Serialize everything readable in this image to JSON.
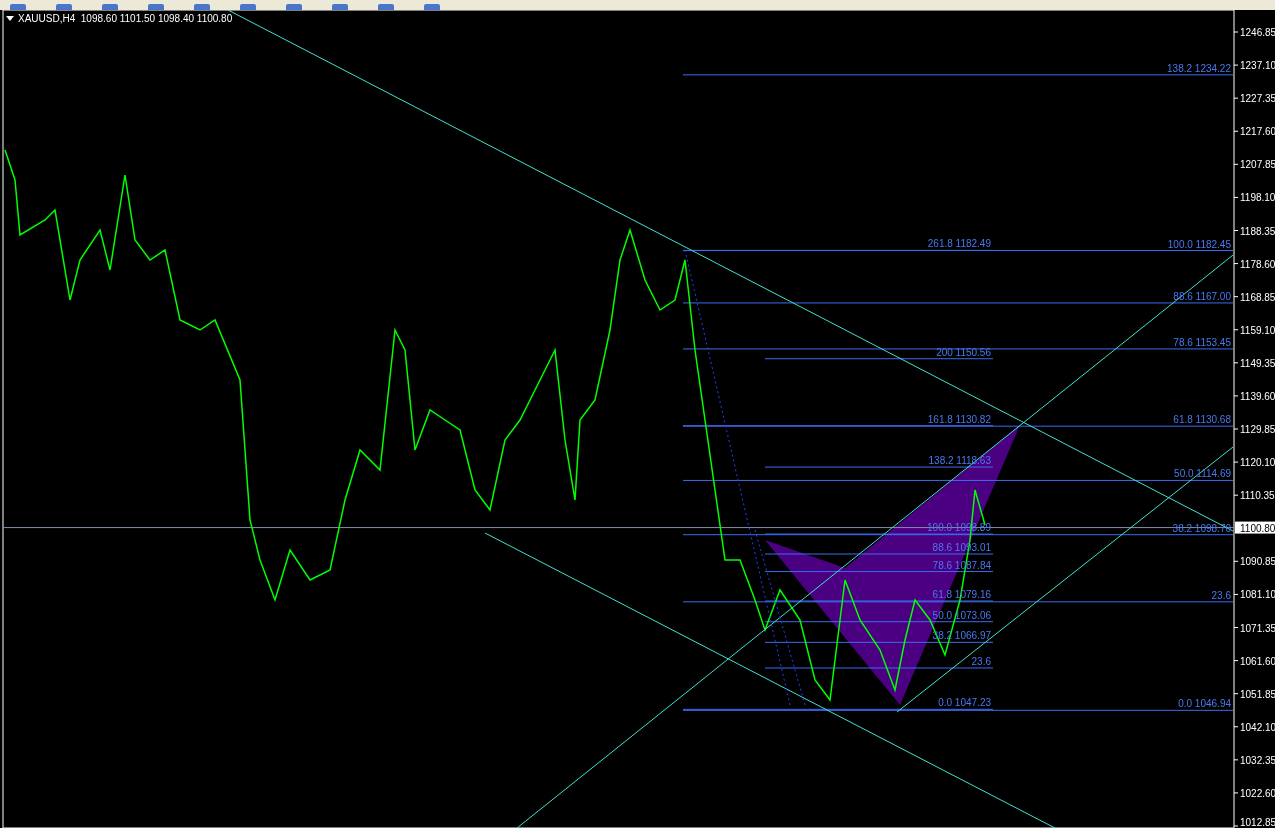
{
  "chart": {
    "title": "XAUUSD,H4  1098.60 1101.50 1098.40 1100.80",
    "axis_labels": [
      "1246.85",
      "1237.10",
      "1227.35",
      "1217.60",
      "1207.85",
      "1198.10",
      "1188.35",
      "1178.60",
      "1168.85",
      "1159.10",
      "1149.35",
      "1139.60",
      "1129.85",
      "1120.10",
      "1110.35",
      "1090.85",
      "1081.10",
      "1071.35",
      "1061.60",
      "1051.85",
      "1042.10",
      "1032.35",
      "1022.60",
      "1012.85"
    ],
    "price_tag": "1100.80",
    "fibonacci_labels": [
      "138.2 1234.22",
      "261.8 1182.49",
      "100.0 1182.45",
      "88.6 1167.00",
      "78.6 1153.45",
      "200 1150.56",
      "161.8 1130.82",
      "61.8 1130.68",
      "138.2 1118.63",
      "50.0 1114.69",
      "100.0 1098.89",
      "38.2 1098.70",
      "88.6 1093.01",
      "78.6 1087.84",
      "61.8 1079.16",
      "23.6",
      "50.0 1073.06",
      "38.2 1066.97",
      "23.6",
      "0.0 1047.23",
      "0.0 1046.94"
    ]
  }
}
